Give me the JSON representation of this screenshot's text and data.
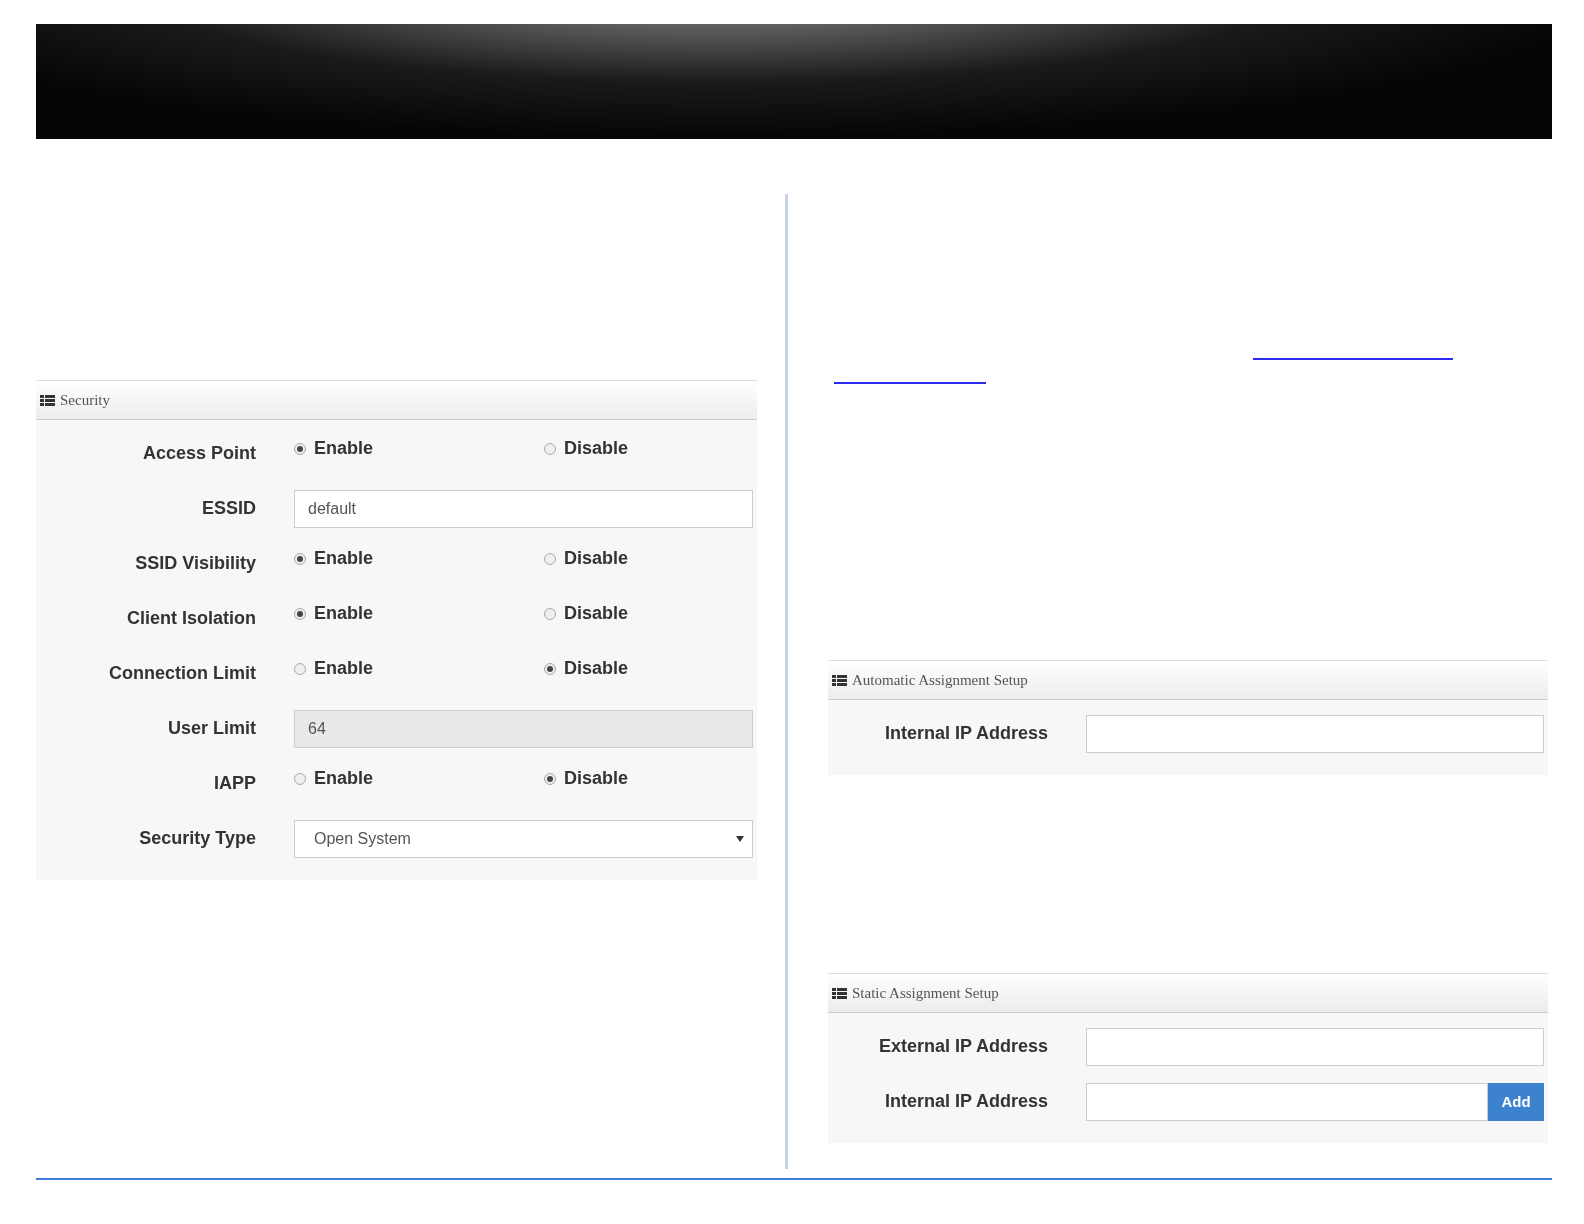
{
  "security": {
    "title": "Security",
    "rows": [
      {
        "kind": "radio",
        "label": "Access Point",
        "options": [
          {
            "label": "Enable",
            "selected": true
          },
          {
            "label": "Disable",
            "selected": false
          }
        ]
      },
      {
        "kind": "text",
        "label": "ESSID",
        "value": "default",
        "disabled": false
      },
      {
        "kind": "radio",
        "label": "SSID Visibility",
        "options": [
          {
            "label": "Enable",
            "selected": true
          },
          {
            "label": "Disable",
            "selected": false
          }
        ]
      },
      {
        "kind": "radio",
        "label": "Client Isolation",
        "options": [
          {
            "label": "Enable",
            "selected": true
          },
          {
            "label": "Disable",
            "selected": false
          }
        ]
      },
      {
        "kind": "radio",
        "label": "Connection Limit",
        "options": [
          {
            "label": "Enable",
            "selected": false
          },
          {
            "label": "Disable",
            "selected": true
          }
        ]
      },
      {
        "kind": "text",
        "label": "User Limit",
        "value": "64",
        "disabled": true
      },
      {
        "kind": "radio",
        "label": "IAPP",
        "options": [
          {
            "label": "Enable",
            "selected": false
          },
          {
            "label": "Disable",
            "selected": true
          }
        ]
      },
      {
        "kind": "select",
        "label": "Security Type",
        "value": "Open System"
      }
    ]
  },
  "automatic_assignment": {
    "title": "Automatic Assignment Setup",
    "rows": [
      {
        "kind": "text",
        "label": "Internal IP Address",
        "value": "",
        "disabled": false
      }
    ]
  },
  "static_assignment": {
    "title": "Static Assignment Setup",
    "rows": [
      {
        "kind": "text",
        "label": "External IP Address",
        "value": "",
        "disabled": false
      },
      {
        "kind": "text_button",
        "label": "Internal IP Address",
        "value": "",
        "button": "Add"
      }
    ]
  }
}
